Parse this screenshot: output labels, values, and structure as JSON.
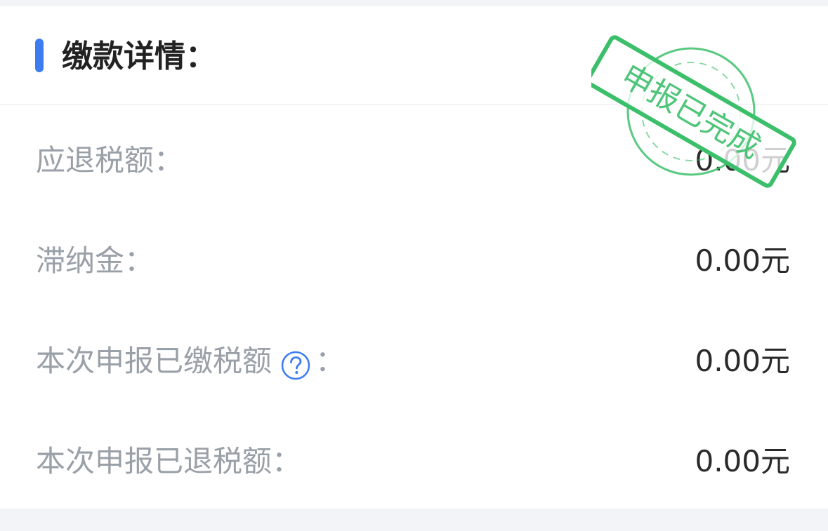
{
  "section": {
    "title": "缴款详情："
  },
  "rows": [
    {
      "label": "应退税额：",
      "value": "0.00元"
    },
    {
      "label": "滞纳金：",
      "value": "0.00元"
    },
    {
      "label": "本次申报已缴税额",
      "label_suffix": "：",
      "value": "0.00元",
      "has_help": true
    },
    {
      "label": "本次申报已退税额：",
      "value": "0.00元"
    }
  ],
  "stamp": {
    "text": "申报已完成",
    "color": "#3bbf6a"
  },
  "colors": {
    "accent": "#3d7cf0",
    "label": "#9aa0a8",
    "value": "#2a2a2a",
    "background": "#f2f4f8"
  },
  "icons": {
    "help": "question-circle-icon"
  }
}
